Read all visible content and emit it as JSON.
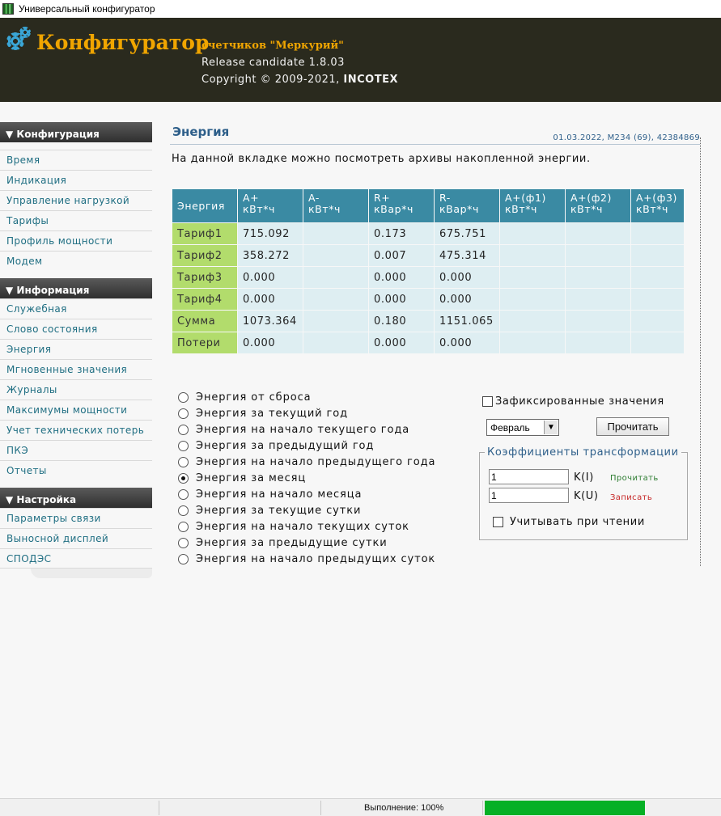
{
  "window": {
    "title": "Универсальный конфигуратор"
  },
  "header": {
    "brand": "Конфигуратор",
    "subtitle": "счетчиков \"Меркурий\"",
    "release": "Release candidate 1.8.03",
    "copyright_prefix": "Copyright © 2009-2021, ",
    "copyright_company": "INCOTEX"
  },
  "sidebar": {
    "sections": [
      {
        "title": "▼ Конфигурация",
        "items": [
          "Время",
          "Индикация",
          "Управление нагрузкой",
          "Тарифы",
          "Профиль мощности",
          "Модем"
        ]
      },
      {
        "title": "▼ Информация",
        "items": [
          "Служебная",
          "Слово состояния",
          "Энергия",
          "Мгновенные значения",
          "Журналы",
          "Максимумы мощности",
          "Учет технических потерь",
          "ПКЭ",
          "Отчеты"
        ]
      },
      {
        "title": "▼ Настройка",
        "items": [
          "Параметры связи",
          "Выносной дисплей",
          "СПОДЭС"
        ]
      }
    ]
  },
  "page": {
    "title": "Энергия",
    "meta": "01.03.2022, M234 (69), 42384869",
    "description": "На данной вкладке можно посмотреть архивы накопленной энергии."
  },
  "table": {
    "label_header": "Энергия",
    "columns": [
      {
        "name": "A+",
        "unit": "кВт*ч"
      },
      {
        "name": "A-",
        "unit": "кВт*ч"
      },
      {
        "name": "R+",
        "unit": "кВар*ч"
      },
      {
        "name": "R-",
        "unit": "кВар*ч"
      },
      {
        "name": "A+(ф1)",
        "unit": "кВт*ч"
      },
      {
        "name": "A+(ф2)",
        "unit": "кВт*ч"
      },
      {
        "name": "A+(ф3)",
        "unit": "кВт*ч"
      }
    ],
    "rows": [
      {
        "label": "Тариф1",
        "values": [
          "715.092",
          "",
          "0.173",
          "675.751",
          "",
          "",
          ""
        ]
      },
      {
        "label": "Тариф2",
        "values": [
          "358.272",
          "",
          "0.007",
          "475.314",
          "",
          "",
          ""
        ]
      },
      {
        "label": "Тариф3",
        "values": [
          "0.000",
          "",
          "0.000",
          "0.000",
          "",
          "",
          ""
        ]
      },
      {
        "label": "Тариф4",
        "values": [
          "0.000",
          "",
          "0.000",
          "0.000",
          "",
          "",
          ""
        ]
      },
      {
        "label": "Сумма",
        "values": [
          "1073.364",
          "",
          "0.180",
          "1151.065",
          "",
          "",
          ""
        ]
      },
      {
        "label": "Потери",
        "values": [
          "0.000",
          "",
          "0.000",
          "0.000",
          "",
          "",
          ""
        ]
      }
    ]
  },
  "radio_options": [
    "Энергия от сброса",
    "Энергия за текущий год",
    "Энергия на начало текущего года",
    "Энергия за предыдущий год",
    "Энергия на начало предыдущего года",
    "Энергия за месяц",
    "Энергия на начало месяца",
    "Энергия за текущие сутки",
    "Энергия на начало текущих суток",
    "Энергия за предыдущие сутки",
    "Энергия на начало предыдущих суток"
  ],
  "radio_selected_index": 5,
  "controls": {
    "fixed_values_label": "Зафиксированные значения",
    "fixed_values_checked": false,
    "month_selected": "Февраль",
    "read_button": "Прочитать"
  },
  "coefficients": {
    "legend": "Коэффициенты трансформации",
    "ki_value": "1",
    "ki_label": "K(I)",
    "ku_value": "1",
    "ku_label": "K(U)",
    "read_link": "Прочитать",
    "write_link": "Записать",
    "apply_on_read_label": "Учитывать при чтении",
    "apply_on_read_checked": false,
    "read_color": "#2e7d32",
    "write_color": "#c62828"
  },
  "statusbar": {
    "progress_text": "Выполнение: 100%",
    "progress_value": 1.0,
    "progress_color": "#06b025"
  }
}
